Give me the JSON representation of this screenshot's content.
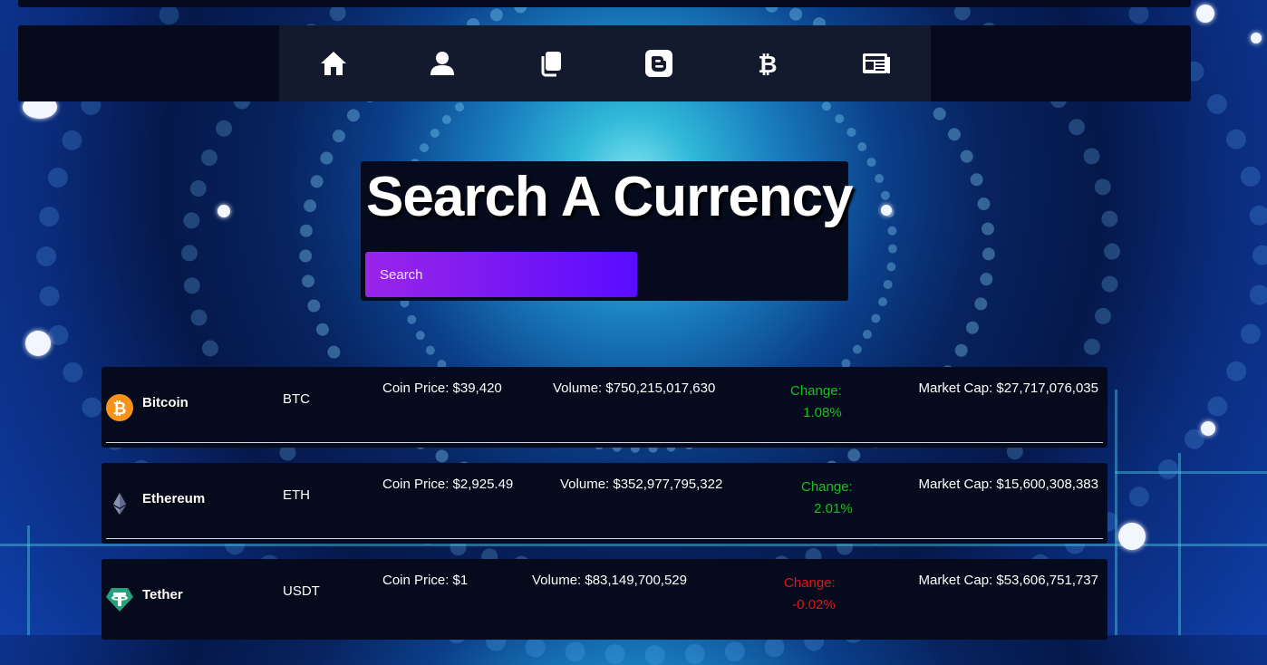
{
  "nav": {
    "items": [
      {
        "icon": "home-icon"
      },
      {
        "icon": "user-icon"
      },
      {
        "icon": "copy-icon"
      },
      {
        "icon": "blogger-icon"
      },
      {
        "icon": "bitcoin-icon"
      },
      {
        "icon": "newspaper-icon"
      }
    ]
  },
  "search": {
    "title": "Search A Currency",
    "placeholder": "Search",
    "value": ""
  },
  "coins": [
    {
      "name": "Bitcoin",
      "symbol": "BTC",
      "icon": "bitcoin-coin-icon",
      "price": "Coin Price: $39,420",
      "volume": "Volume: $750,215,017,630",
      "change_label": "Change:",
      "change_value": "1.08%",
      "change_dir": "up",
      "market_cap": "Market Cap: $27,717,076,035"
    },
    {
      "name": "Ethereum",
      "symbol": "ETH",
      "icon": "ethereum-coin-icon",
      "price": "Coin Price: $2,925.49",
      "volume": "Volume: $352,977,795,322",
      "change_label": "Change:",
      "change_value": "2.01%",
      "change_dir": "up",
      "market_cap": "Market Cap: $15,600,308,383"
    },
    {
      "name": "Tether",
      "symbol": "USDT",
      "icon": "tether-coin-icon",
      "price": "Coin Price: $1",
      "volume": "Volume: $83,149,700,529",
      "change_label": "Change:",
      "change_value": "-0.02%",
      "change_dir": "down",
      "market_cap": "Market Cap: $53,606,751,737"
    }
  ],
  "colors": {
    "up": "#14c21c",
    "down": "#e0141c",
    "panel": "#050a1c",
    "search_gradient_start": "#9a25e8",
    "search_gradient_end": "#5a0cff"
  }
}
